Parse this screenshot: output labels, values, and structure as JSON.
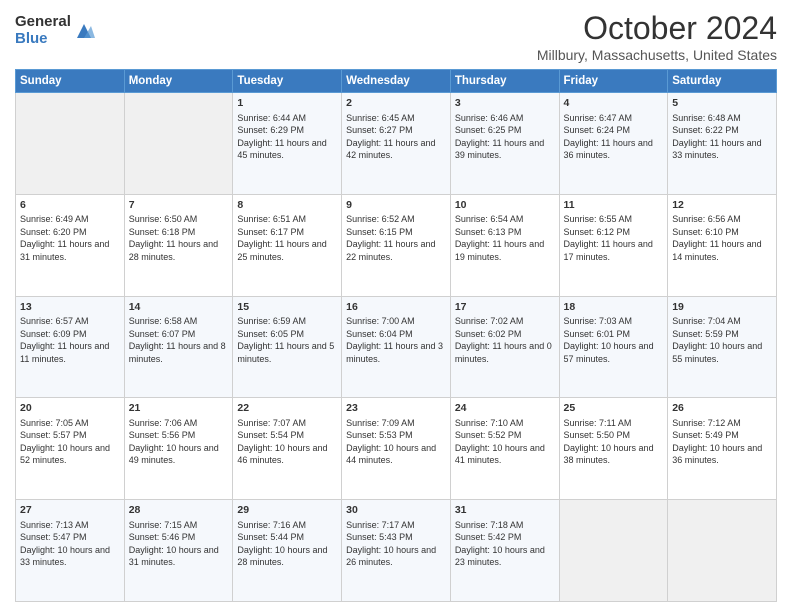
{
  "logo": {
    "general": "General",
    "blue": "Blue"
  },
  "header": {
    "title": "October 2024",
    "subtitle": "Millbury, Massachusetts, United States"
  },
  "weekdays": [
    "Sunday",
    "Monday",
    "Tuesday",
    "Wednesday",
    "Thursday",
    "Friday",
    "Saturday"
  ],
  "weeks": [
    [
      {
        "day": "",
        "sunrise": "",
        "sunset": "",
        "daylight": ""
      },
      {
        "day": "",
        "sunrise": "",
        "sunset": "",
        "daylight": ""
      },
      {
        "day": "1",
        "sunrise": "Sunrise: 6:44 AM",
        "sunset": "Sunset: 6:29 PM",
        "daylight": "Daylight: 11 hours and 45 minutes."
      },
      {
        "day": "2",
        "sunrise": "Sunrise: 6:45 AM",
        "sunset": "Sunset: 6:27 PM",
        "daylight": "Daylight: 11 hours and 42 minutes."
      },
      {
        "day": "3",
        "sunrise": "Sunrise: 6:46 AM",
        "sunset": "Sunset: 6:25 PM",
        "daylight": "Daylight: 11 hours and 39 minutes."
      },
      {
        "day": "4",
        "sunrise": "Sunrise: 6:47 AM",
        "sunset": "Sunset: 6:24 PM",
        "daylight": "Daylight: 11 hours and 36 minutes."
      },
      {
        "day": "5",
        "sunrise": "Sunrise: 6:48 AM",
        "sunset": "Sunset: 6:22 PM",
        "daylight": "Daylight: 11 hours and 33 minutes."
      }
    ],
    [
      {
        "day": "6",
        "sunrise": "Sunrise: 6:49 AM",
        "sunset": "Sunset: 6:20 PM",
        "daylight": "Daylight: 11 hours and 31 minutes."
      },
      {
        "day": "7",
        "sunrise": "Sunrise: 6:50 AM",
        "sunset": "Sunset: 6:18 PM",
        "daylight": "Daylight: 11 hours and 28 minutes."
      },
      {
        "day": "8",
        "sunrise": "Sunrise: 6:51 AM",
        "sunset": "Sunset: 6:17 PM",
        "daylight": "Daylight: 11 hours and 25 minutes."
      },
      {
        "day": "9",
        "sunrise": "Sunrise: 6:52 AM",
        "sunset": "Sunset: 6:15 PM",
        "daylight": "Daylight: 11 hours and 22 minutes."
      },
      {
        "day": "10",
        "sunrise": "Sunrise: 6:54 AM",
        "sunset": "Sunset: 6:13 PM",
        "daylight": "Daylight: 11 hours and 19 minutes."
      },
      {
        "day": "11",
        "sunrise": "Sunrise: 6:55 AM",
        "sunset": "Sunset: 6:12 PM",
        "daylight": "Daylight: 11 hours and 17 minutes."
      },
      {
        "day": "12",
        "sunrise": "Sunrise: 6:56 AM",
        "sunset": "Sunset: 6:10 PM",
        "daylight": "Daylight: 11 hours and 14 minutes."
      }
    ],
    [
      {
        "day": "13",
        "sunrise": "Sunrise: 6:57 AM",
        "sunset": "Sunset: 6:09 PM",
        "daylight": "Daylight: 11 hours and 11 minutes."
      },
      {
        "day": "14",
        "sunrise": "Sunrise: 6:58 AM",
        "sunset": "Sunset: 6:07 PM",
        "daylight": "Daylight: 11 hours and 8 minutes."
      },
      {
        "day": "15",
        "sunrise": "Sunrise: 6:59 AM",
        "sunset": "Sunset: 6:05 PM",
        "daylight": "Daylight: 11 hours and 5 minutes."
      },
      {
        "day": "16",
        "sunrise": "Sunrise: 7:00 AM",
        "sunset": "Sunset: 6:04 PM",
        "daylight": "Daylight: 11 hours and 3 minutes."
      },
      {
        "day": "17",
        "sunrise": "Sunrise: 7:02 AM",
        "sunset": "Sunset: 6:02 PM",
        "daylight": "Daylight: 11 hours and 0 minutes."
      },
      {
        "day": "18",
        "sunrise": "Sunrise: 7:03 AM",
        "sunset": "Sunset: 6:01 PM",
        "daylight": "Daylight: 10 hours and 57 minutes."
      },
      {
        "day": "19",
        "sunrise": "Sunrise: 7:04 AM",
        "sunset": "Sunset: 5:59 PM",
        "daylight": "Daylight: 10 hours and 55 minutes."
      }
    ],
    [
      {
        "day": "20",
        "sunrise": "Sunrise: 7:05 AM",
        "sunset": "Sunset: 5:57 PM",
        "daylight": "Daylight: 10 hours and 52 minutes."
      },
      {
        "day": "21",
        "sunrise": "Sunrise: 7:06 AM",
        "sunset": "Sunset: 5:56 PM",
        "daylight": "Daylight: 10 hours and 49 minutes."
      },
      {
        "day": "22",
        "sunrise": "Sunrise: 7:07 AM",
        "sunset": "Sunset: 5:54 PM",
        "daylight": "Daylight: 10 hours and 46 minutes."
      },
      {
        "day": "23",
        "sunrise": "Sunrise: 7:09 AM",
        "sunset": "Sunset: 5:53 PM",
        "daylight": "Daylight: 10 hours and 44 minutes."
      },
      {
        "day": "24",
        "sunrise": "Sunrise: 7:10 AM",
        "sunset": "Sunset: 5:52 PM",
        "daylight": "Daylight: 10 hours and 41 minutes."
      },
      {
        "day": "25",
        "sunrise": "Sunrise: 7:11 AM",
        "sunset": "Sunset: 5:50 PM",
        "daylight": "Daylight: 10 hours and 38 minutes."
      },
      {
        "day": "26",
        "sunrise": "Sunrise: 7:12 AM",
        "sunset": "Sunset: 5:49 PM",
        "daylight": "Daylight: 10 hours and 36 minutes."
      }
    ],
    [
      {
        "day": "27",
        "sunrise": "Sunrise: 7:13 AM",
        "sunset": "Sunset: 5:47 PM",
        "daylight": "Daylight: 10 hours and 33 minutes."
      },
      {
        "day": "28",
        "sunrise": "Sunrise: 7:15 AM",
        "sunset": "Sunset: 5:46 PM",
        "daylight": "Daylight: 10 hours and 31 minutes."
      },
      {
        "day": "29",
        "sunrise": "Sunrise: 7:16 AM",
        "sunset": "Sunset: 5:44 PM",
        "daylight": "Daylight: 10 hours and 28 minutes."
      },
      {
        "day": "30",
        "sunrise": "Sunrise: 7:17 AM",
        "sunset": "Sunset: 5:43 PM",
        "daylight": "Daylight: 10 hours and 26 minutes."
      },
      {
        "day": "31",
        "sunrise": "Sunrise: 7:18 AM",
        "sunset": "Sunset: 5:42 PM",
        "daylight": "Daylight: 10 hours and 23 minutes."
      },
      {
        "day": "",
        "sunrise": "",
        "sunset": "",
        "daylight": ""
      },
      {
        "day": "",
        "sunrise": "",
        "sunset": "",
        "daylight": ""
      }
    ]
  ]
}
